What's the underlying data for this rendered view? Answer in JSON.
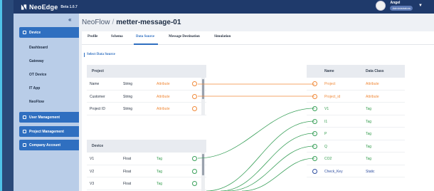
{
  "topbar": {
    "logo_text": "NeoEdge",
    "beta": "Beta 1.0.7",
    "user_name": "Angel",
    "user_role": "Administrators"
  },
  "sidebar": {
    "collapse": "«",
    "groups": [
      {
        "label": "Device",
        "caret": "^"
      },
      {
        "label": "User Management",
        "caret": "v"
      },
      {
        "label": "Project Management",
        "caret": "v"
      },
      {
        "label": "Company Account",
        "caret": "v"
      }
    ],
    "device_items": [
      "Dashboard",
      "Gateway",
      "OT Device",
      "IT App",
      "NeoFlow"
    ]
  },
  "main": {
    "breadcrumb_root": "NeoFlow",
    "breadcrumb_sep": "/",
    "flow_name": "metter-message-01",
    "tabs": [
      "Profile",
      "Schema",
      "Data Source",
      "Message Destination",
      "Simulation"
    ],
    "active_tab": "Data Source",
    "section_title": "Select Data Source"
  },
  "project_table": {
    "header": "Project",
    "rows": [
      {
        "name": "Name",
        "type": "String",
        "cls": "Attribute"
      },
      {
        "name": "Customer",
        "type": "String",
        "cls": "Attribute"
      },
      {
        "name": "Project ID",
        "type": "String",
        "cls": "Attribute"
      }
    ]
  },
  "device_table": {
    "header": "Device",
    "rows": [
      {
        "name": "V1",
        "type": "Float",
        "cls": "Tag"
      },
      {
        "name": "V2",
        "type": "Float",
        "cls": "Tag"
      },
      {
        "name": "V3",
        "type": "Float",
        "cls": "Tag"
      }
    ]
  },
  "target_table": {
    "col_name": "Name",
    "col_class": "Data Class",
    "rows": [
      {
        "name": "Project",
        "cls": "Attribute"
      },
      {
        "name": "Project_id",
        "cls": "Attribute"
      },
      {
        "name": "V1",
        "cls": "Tag"
      },
      {
        "name": "I1",
        "cls": "Tag"
      },
      {
        "name": "P",
        "cls": "Tag"
      },
      {
        "name": "Q",
        "cls": "Tag"
      },
      {
        "name": "CO2",
        "cls": "Tag"
      },
      {
        "name": "Check_Key",
        "cls": "Static"
      }
    ]
  },
  "colors": {
    "brand_dark": "#1f3a6b",
    "accent": "#2f6fc0",
    "attribute": "#f08a3a",
    "tag": "#2f9a4a",
    "static": "#2f4fa0"
  }
}
